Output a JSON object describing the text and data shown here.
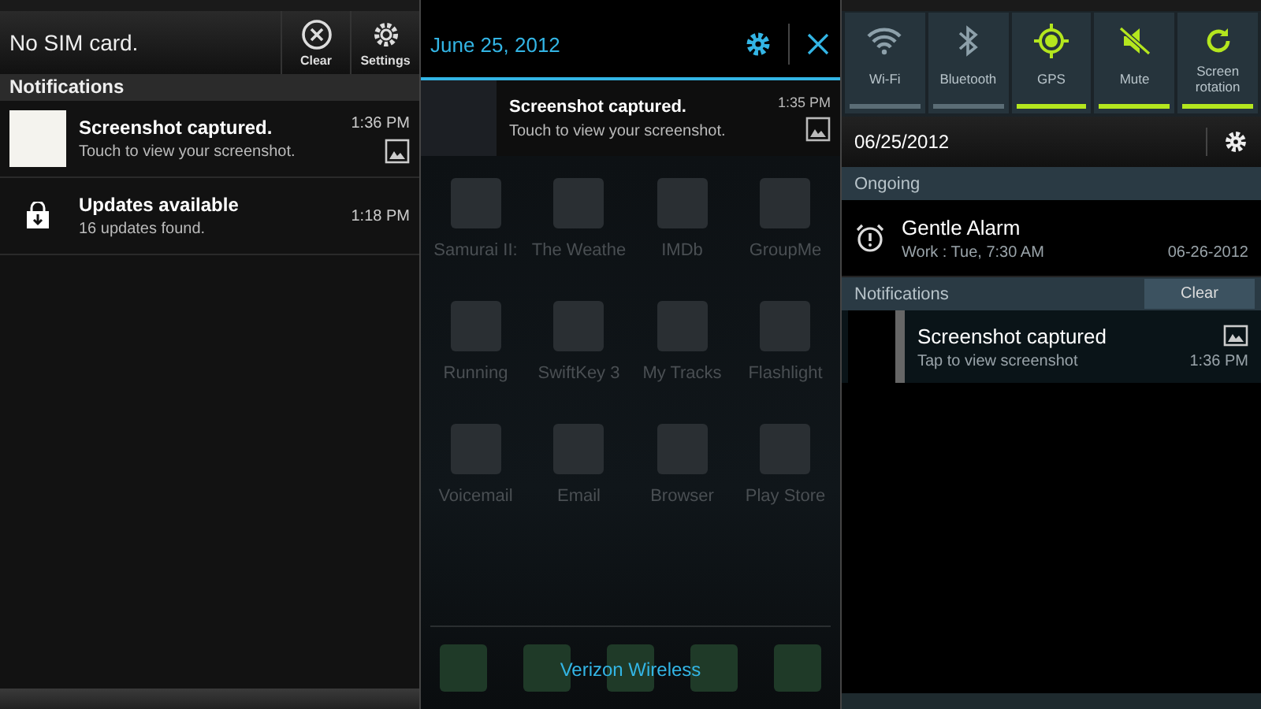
{
  "htc_panel": {
    "header": {
      "status": "No SIM card.",
      "buttons": [
        {
          "kind": "clear",
          "label": "Clear"
        },
        {
          "kind": "settings",
          "label": "Settings"
        }
      ]
    },
    "section_title": "Notifications",
    "notifications": [
      {
        "kind": "thumbnail",
        "title": "Screenshot captured.",
        "text": "Touch to view your screenshot.",
        "time": "1:36 PM"
      },
      {
        "kind": "update",
        "title": "Updates available",
        "text": "16 updates found.",
        "time": "1:18 PM"
      }
    ]
  },
  "ics_panel": {
    "date": "June 25, 2012",
    "notification": {
      "title": "Screenshot captured.",
      "text": "Touch to view your screenshot.",
      "time": "1:35 PM"
    },
    "apps": [
      {
        "label": "Samurai II:"
      },
      {
        "label": "The Weathe"
      },
      {
        "label": "IMDb"
      },
      {
        "label": "GroupMe"
      },
      {
        "label": "Running"
      },
      {
        "label": "SwiftKey 3"
      },
      {
        "label": "My Tracks"
      },
      {
        "label": "Flashlight"
      },
      {
        "label": "Voicemail"
      },
      {
        "label": "Email"
      },
      {
        "label": "Browser"
      },
      {
        "label": "Play Store"
      }
    ],
    "carrier": "Verizon Wireless"
  },
  "samsung_panel": {
    "toggles": [
      {
        "kind": "wifi",
        "label": "Wi-Fi",
        "on": false
      },
      {
        "kind": "bluetooth",
        "label": "Bluetooth",
        "on": false
      },
      {
        "kind": "gps",
        "label": "GPS",
        "on": true
      },
      {
        "kind": "mute",
        "label": "Mute",
        "on": true
      },
      {
        "kind": "rotation",
        "label": "Screen rotation",
        "on": true
      }
    ],
    "date": "06/25/2012",
    "ongoing_title": "Ongoing",
    "alarm": {
      "title": "Gentle Alarm",
      "text": "Work : Tue, 7:30 AM",
      "date": "06-26-2012"
    },
    "notifications_title": "Notifications",
    "clear_label": "Clear",
    "notification": {
      "title": "Screenshot captured",
      "text": "Tap to view screenshot",
      "time": "1:36 PM"
    }
  }
}
